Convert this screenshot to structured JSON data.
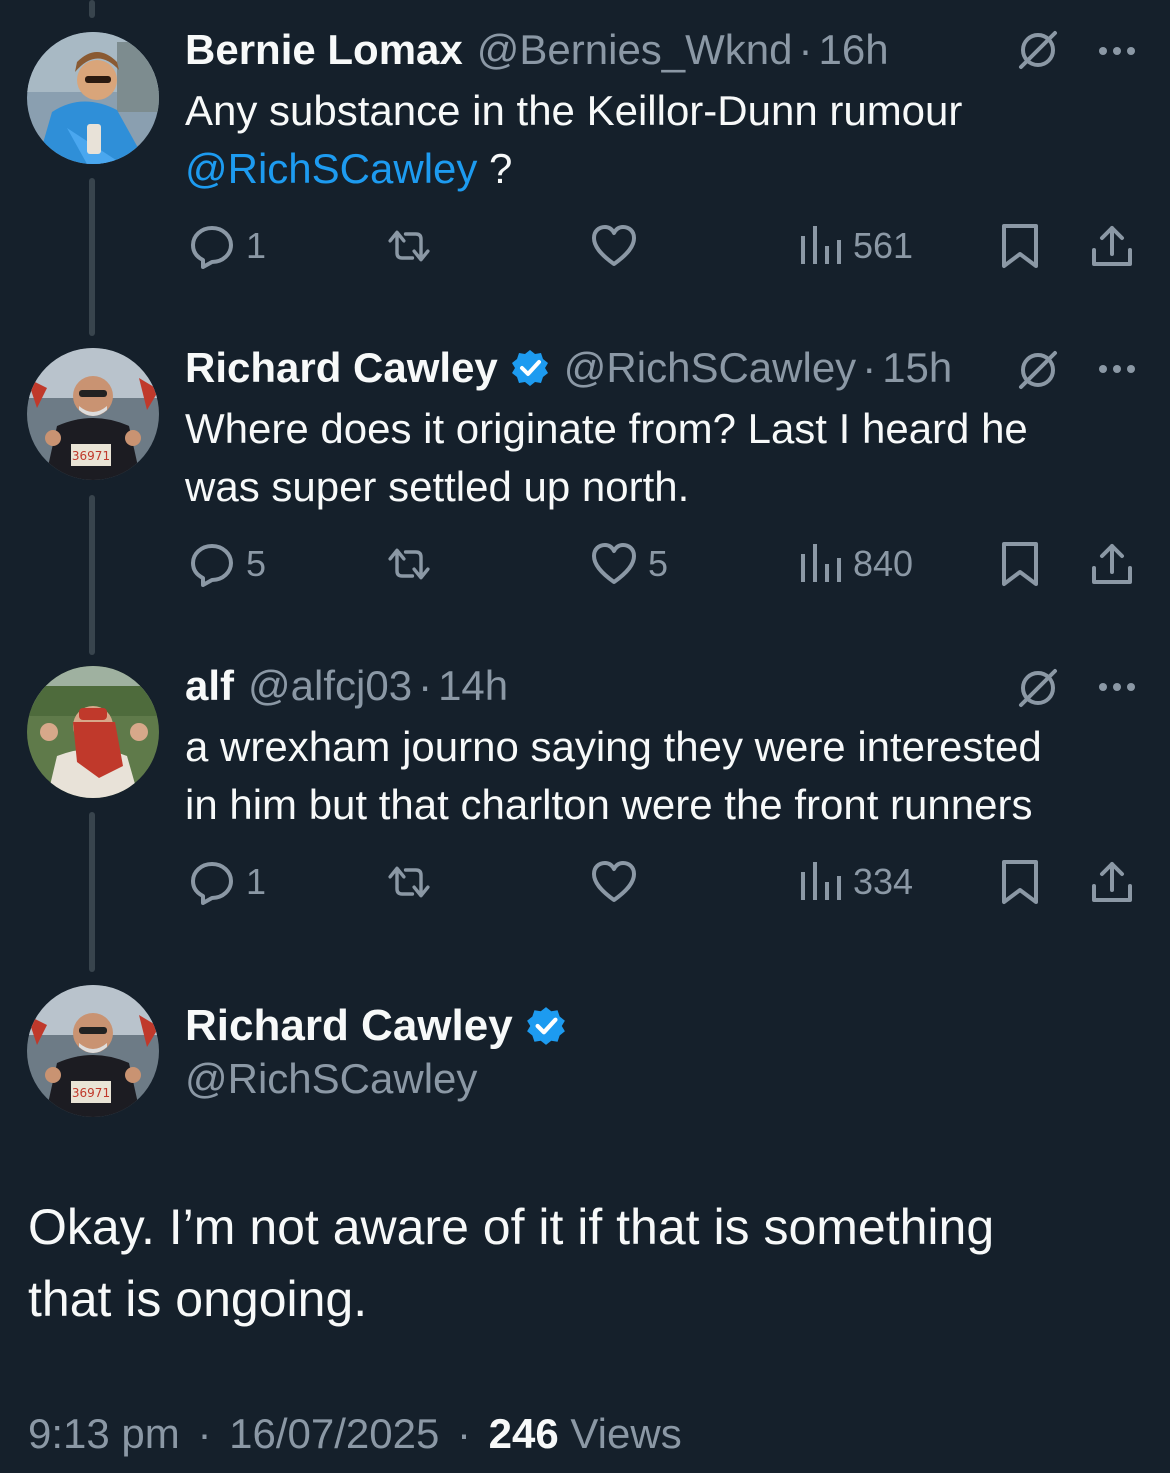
{
  "tweets": [
    {
      "name": "Bernie Lomax",
      "handle": "@Bernies_Wknd",
      "time": "16h",
      "verified": false,
      "text": "Any substance in the Keillor-Dunn rumour",
      "mention": "@RichSCawley",
      "text_after": " ?",
      "replies": "1",
      "retweets": "",
      "likes": "",
      "views": "561"
    },
    {
      "name": "Richard Cawley",
      "handle": "@RichSCawley",
      "time": "15h",
      "verified": true,
      "text_line1": "Where does it originate from? Last I heard he",
      "text_line2": "was super settled up north.",
      "replies": "5",
      "retweets": "",
      "likes": "5",
      "views": "840"
    },
    {
      "name": "alf",
      "handle": "@alfcj03",
      "time": "14h",
      "verified": false,
      "text_line1": "a wrexham journo saying they were interested",
      "text_line2": "in him but that charlton were the front runners",
      "replies": "1",
      "retweets": "",
      "likes": "",
      "views": "334"
    }
  ],
  "main_tweet": {
    "name": "Richard Cawley",
    "handle": "@RichSCawley",
    "verified": true,
    "text_line1": "Okay. I’m not aware of it if that is something",
    "text_line2": "that is ongoing.",
    "time": "9:13 pm",
    "date": "16/07/2025",
    "views_count": "246",
    "views_label": "Views"
  },
  "separator": "·",
  "icons": {
    "reply": "reply-icon",
    "retweet": "retweet-icon",
    "like": "heart-icon",
    "views": "views-icon",
    "bookmark": "bookmark-icon",
    "share": "share-icon",
    "grok": "grok-icon",
    "more": "more-icon",
    "verified": "verified-badge-icon"
  },
  "colors": {
    "background": "#15202b",
    "text": "#f7f9f9",
    "secondary": "#8b98a5",
    "accent": "#1d9bf0",
    "thread_line": "#38444d"
  }
}
